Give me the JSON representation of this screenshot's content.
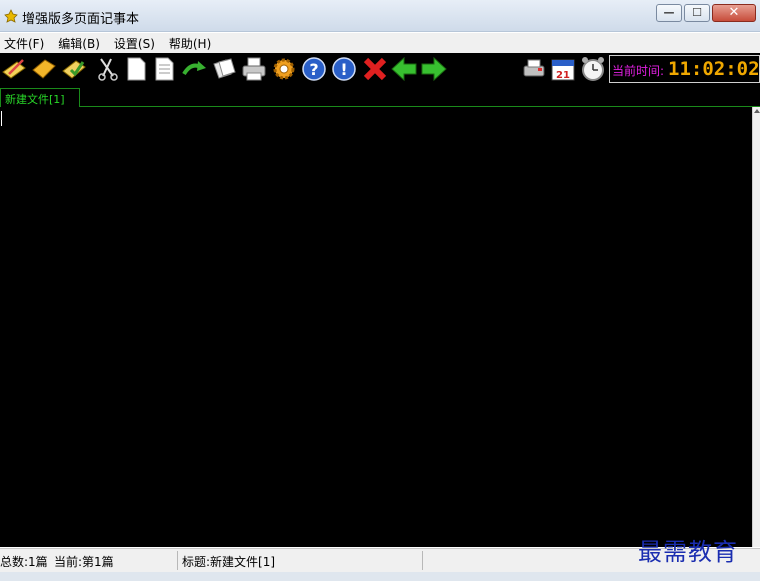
{
  "window": {
    "title": "增强版多页面记事本",
    "minimize_glyph": "—",
    "maximize_glyph": "☐",
    "close_glyph": "✕"
  },
  "menu": {
    "items": [
      {
        "label": "文件(F)"
      },
      {
        "label": "编辑(B)"
      },
      {
        "label": "设置(S)"
      },
      {
        "label": "帮助(H)"
      }
    ]
  },
  "toolbar": {
    "icons": [
      "new-note-icon",
      "open-folder-icon",
      "save-icon",
      "scissors-icon",
      "blank-page-icon",
      "document-icon",
      "redo-arrow-icon",
      "copy-pages-icon",
      "printer-icon",
      "gear-icon",
      "help-icon",
      "info-icon",
      "delete-icon",
      "back-arrow-icon",
      "forward-arrow-icon",
      "printer-alt-icon",
      "calendar-icon",
      "alarm-clock-icon"
    ],
    "calendar_day": "21",
    "clock_label": "当前时间:",
    "clock_time": "11:02:02"
  },
  "tabs": [
    {
      "label": "新建文件[1]",
      "active": true
    }
  ],
  "status": {
    "total": "总数:1篇",
    "current": "当前:第1篇",
    "title": "标题:新建文件[1]"
  },
  "watermark": "最需教育",
  "colors": {
    "editor_bg": "#000000",
    "tab_text": "#29d829",
    "clock_label": "#e020e0",
    "clock_digits": "#f0a800",
    "watermark": "#1a2db0"
  }
}
